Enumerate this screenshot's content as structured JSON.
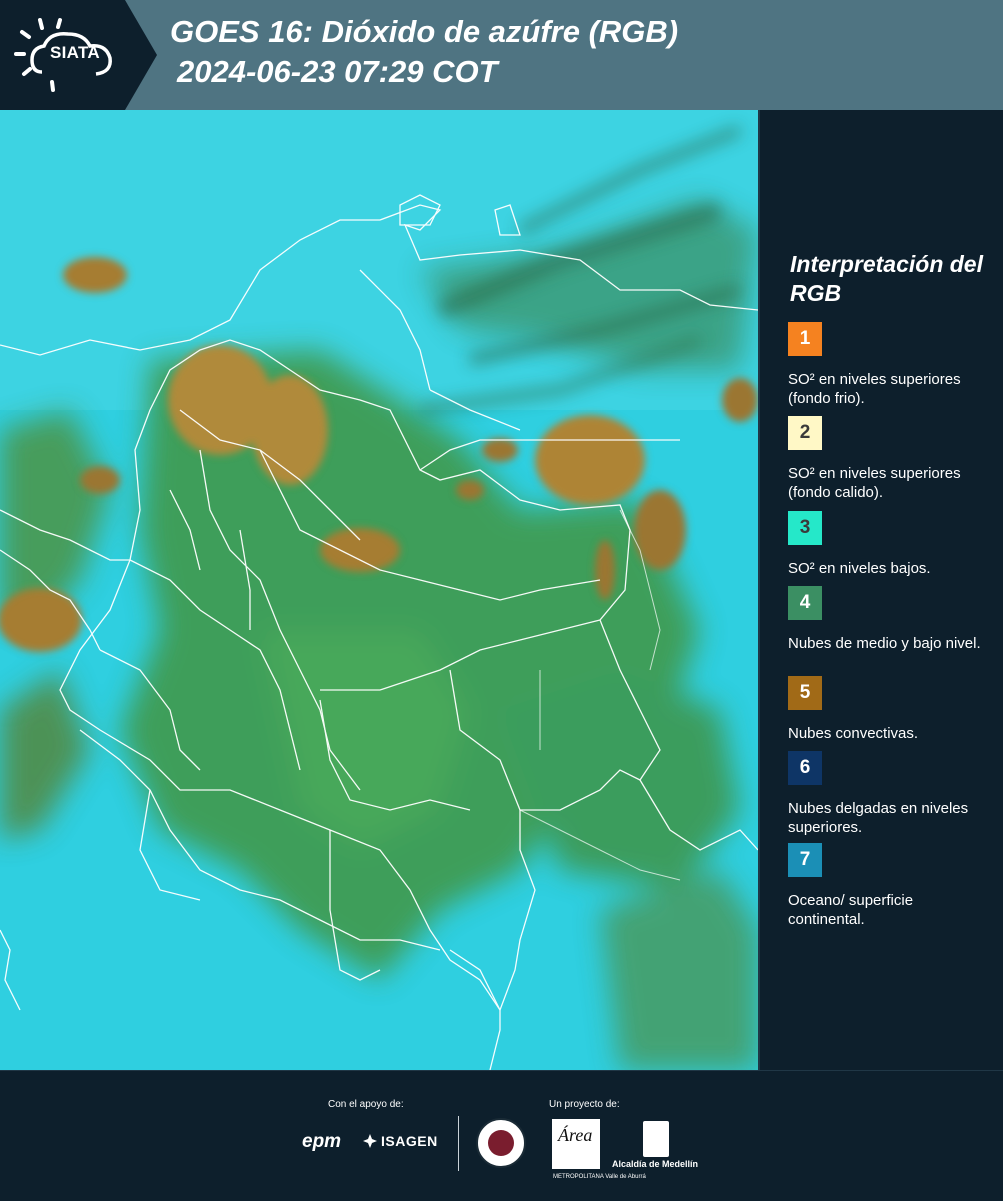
{
  "header": {
    "logo_text": "SIATA",
    "title_line1": "GOES 16: Dióxido de azúfre (RGB)",
    "title_line2": "2024-06-23 07:29 COT",
    "background_color": "#4f7482"
  },
  "legend": {
    "title": "Interpretación del RGB",
    "items": [
      {
        "number": "1",
        "color": "#f58220",
        "text": "SO² en niveles superiores (fondo frio)."
      },
      {
        "number": "2",
        "color": "#fff8c6",
        "text": "SO² en niveles superiores (fondo calido)."
      },
      {
        "number": "3",
        "color": "#25e8c9",
        "text": "SO² en niveles bajos."
      },
      {
        "number": "4",
        "color": "#3b8f63",
        "text": "Nubes de medio y bajo nivel."
      },
      {
        "number": "5",
        "color": "#a16a17",
        "text": "Nubes convectivas."
      },
      {
        "number": "6",
        "color": "#0e3566",
        "text": "Nubes delgadas en niveles superiores."
      },
      {
        "number": "7",
        "color": "#1b8fb6",
        "text": "Oceano/ superficie continental."
      }
    ]
  },
  "footer": {
    "support_label": "Con el apoyo de:",
    "project_label": "Un proyecto de:",
    "sponsor_1": "epm",
    "sponsor_2": "ISAGEN",
    "partner_area": "Área",
    "partner_area_sub": "METROPOLITANA Valle de Aburrá",
    "partner_alcaldia": "Alcaldía de Medellín"
  }
}
